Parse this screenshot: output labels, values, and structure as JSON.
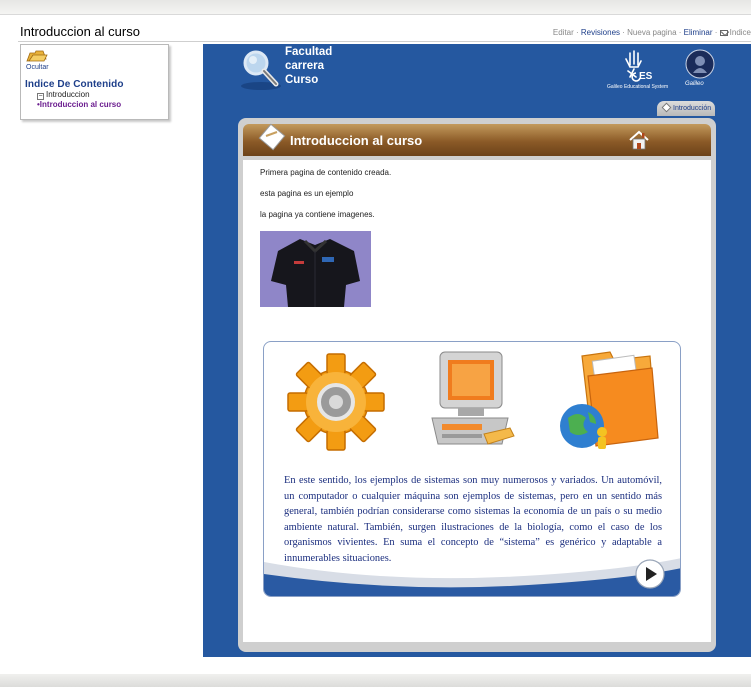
{
  "page": {
    "title": "Introduccion al curso",
    "actions": {
      "edit": "Editar",
      "revisions": "Revisiones",
      "new_page": "Nueva pagina",
      "delete": "Eliminar",
      "index": "Indice"
    }
  },
  "sidebar": {
    "hide_label": "Ocultar",
    "heading": "Indice De Contenido",
    "root_item": "Introduccion",
    "child_item": "•Introduccion al curso"
  },
  "header": {
    "line1": "Facultad",
    "line2": "carrera",
    "line3": "Curso",
    "ges_caption": "Galileo Educational System",
    "galileo_caption": "Galileo"
  },
  "tab": {
    "label": "Introducción"
  },
  "banner": {
    "title": "Introduccion al curso"
  },
  "content": {
    "paragraphs": [
      "Primera pagina de contenido creada.",
      " esta pagina es un ejemplo",
      "la pagina ya contiene imagenes."
    ],
    "card_text": "En este sentido, los ejemplos de sistemas son muy numerosos y variados. Un automóvil, un computador o cualquier máquina son ejemplos de sistemas, pero en un sentido más general, también podrían considerarse como sistemas la economía de un país o su medio ambiente natural. También, surgen ilustraciones de la biología, como el caso de los organismos vivientes. En suma el concepto de “sistema” es genérico y adaptable a innumerables situaciones."
  },
  "icons": {
    "hide": "folder-hand-icon",
    "magnifier": "magnifier-icon",
    "home": "home-icon",
    "play": "play-icon"
  },
  "colors": {
    "frame_blue": "#2558a0",
    "banner_brown": "#8b5a27",
    "link_blue": "#1e3f8a",
    "active_purple": "#6b1d8f",
    "card_text": "#1c2f7f"
  }
}
